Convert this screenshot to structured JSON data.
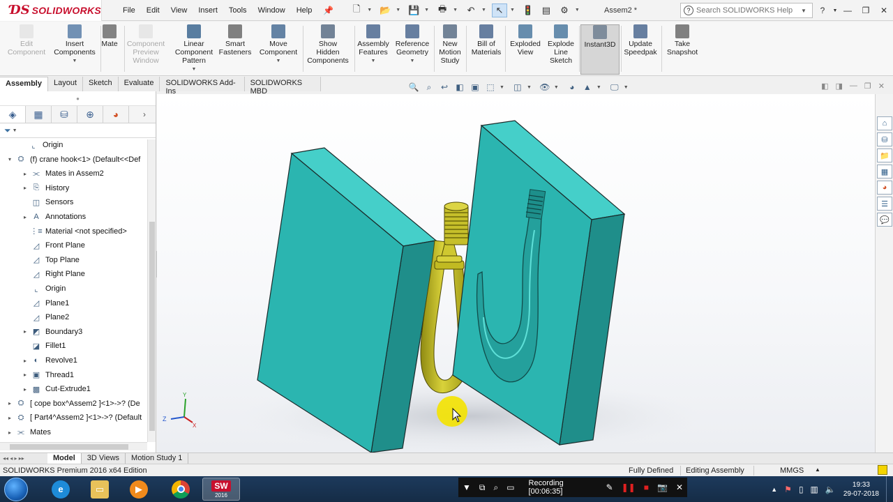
{
  "app": {
    "brand": "SOLIDWORKS",
    "doc_title": "Assem2 *",
    "search_placeholder": "Search SOLIDWORKS Help"
  },
  "menu": [
    "File",
    "Edit",
    "View",
    "Insert",
    "Tools",
    "Window",
    "Help"
  ],
  "commands": [
    {
      "id": "edit-component",
      "label": [
        "Edit",
        "Component"
      ],
      "disabled": true,
      "caret": false
    },
    {
      "id": "insert-components",
      "label": [
        "Insert",
        "Components"
      ],
      "disabled": false,
      "caret": true
    },
    {
      "id": "mate",
      "label": [
        "Mate"
      ],
      "disabled": false,
      "caret": false
    },
    {
      "id": "component-preview-window",
      "label": [
        "Component",
        "Preview",
        "Window"
      ],
      "disabled": true,
      "caret": false
    },
    {
      "id": "linear-component-pattern",
      "label": [
        "Linear",
        "Component",
        "Pattern"
      ],
      "disabled": false,
      "caret": true
    },
    {
      "id": "smart-fasteners",
      "label": [
        "Smart",
        "Fasteners"
      ],
      "disabled": false,
      "caret": false
    },
    {
      "id": "move-component",
      "label": [
        "Move",
        "Component"
      ],
      "disabled": false,
      "caret": true
    },
    {
      "id": "show-hidden-components",
      "label": [
        "Show",
        "Hidden",
        "Components"
      ],
      "disabled": false,
      "caret": false
    },
    {
      "id": "assembly-features",
      "label": [
        "Assembly",
        "Features"
      ],
      "disabled": false,
      "caret": true
    },
    {
      "id": "reference-geometry",
      "label": [
        "Reference",
        "Geometry"
      ],
      "disabled": false,
      "caret": true
    },
    {
      "id": "new-motion-study",
      "label": [
        "New",
        "Motion",
        "Study"
      ],
      "disabled": false,
      "caret": false
    },
    {
      "id": "bill-of-materials",
      "label": [
        "Bill of",
        "Materials"
      ],
      "disabled": false,
      "caret": false
    },
    {
      "id": "exploded-view",
      "label": [
        "Exploded",
        "View"
      ],
      "disabled": false,
      "caret": false
    },
    {
      "id": "explode-line-sketch",
      "label": [
        "Explode",
        "Line",
        "Sketch"
      ],
      "disabled": false,
      "caret": false
    },
    {
      "id": "instant3d",
      "label": [
        "Instant3D"
      ],
      "disabled": false,
      "caret": false,
      "active": true
    },
    {
      "id": "update-speedpak",
      "label": [
        "Update",
        "Speedpak"
      ],
      "disabled": false,
      "caret": false
    },
    {
      "id": "take-snapshot",
      "label": [
        "Take",
        "Snapshot"
      ],
      "disabled": false,
      "caret": false
    }
  ],
  "tabs": [
    "Assembly",
    "Layout",
    "Sketch",
    "Evaluate",
    "SOLIDWORKS Add-Ins",
    "SOLIDWORKS MBD"
  ],
  "active_tab": "Assembly",
  "tree": [
    {
      "label": "Origin",
      "depth": 1,
      "expander": "",
      "icon": "origin-icon"
    },
    {
      "label": "(f) crane hook<1> (Default<<Def",
      "depth": 0,
      "expander": "▾",
      "icon": "part-icon"
    },
    {
      "label": "Mates in Assem2",
      "depth": 2,
      "expander": "▸",
      "icon": "mates-icon"
    },
    {
      "label": "History",
      "depth": 2,
      "expander": "▸",
      "icon": "history-icon"
    },
    {
      "label": "Sensors",
      "depth": 2,
      "expander": "",
      "icon": "sensors-icon"
    },
    {
      "label": "Annotations",
      "depth": 2,
      "expander": "▸",
      "icon": "annotations-icon"
    },
    {
      "label": "Material <not specified>",
      "depth": 2,
      "expander": "",
      "icon": "material-icon"
    },
    {
      "label": "Front Plane",
      "depth": 2,
      "expander": "",
      "icon": "plane-icon"
    },
    {
      "label": "Top Plane",
      "depth": 2,
      "expander": "",
      "icon": "plane-icon"
    },
    {
      "label": "Right Plane",
      "depth": 2,
      "expander": "",
      "icon": "plane-icon"
    },
    {
      "label": "Origin",
      "depth": 2,
      "expander": "",
      "icon": "origin-icon"
    },
    {
      "label": "Plane1",
      "depth": 2,
      "expander": "",
      "icon": "plane-icon"
    },
    {
      "label": "Plane2",
      "depth": 2,
      "expander": "",
      "icon": "plane-icon"
    },
    {
      "label": "Boundary3",
      "depth": 2,
      "expander": "▸",
      "icon": "boundary-icon"
    },
    {
      "label": "Fillet1",
      "depth": 2,
      "expander": "",
      "icon": "fillet-icon"
    },
    {
      "label": "Revolve1",
      "depth": 2,
      "expander": "▸",
      "icon": "revolve-icon"
    },
    {
      "label": "Thread1",
      "depth": 2,
      "expander": "▸",
      "icon": "thread-icon"
    },
    {
      "label": "Cut-Extrude1",
      "depth": 2,
      "expander": "▸",
      "icon": "cut-extrude-icon"
    },
    {
      "label": "[ cope box^Assem2 ]<1>->? (De",
      "depth": 0,
      "expander": "▸",
      "icon": "part-icon"
    },
    {
      "label": "[ Part4^Assem2 ]<1>->? (Default",
      "depth": 0,
      "expander": "▸",
      "icon": "part-icon"
    },
    {
      "label": "Mates",
      "depth": 0,
      "expander": "▸",
      "icon": "mates-icon"
    }
  ],
  "bottom_tabs": [
    "Model",
    "3D Views",
    "Motion Study 1"
  ],
  "status": {
    "edition": "SOLIDWORKS Premium 2016 x64 Edition",
    "state": "Fully Defined",
    "mode": "Editing Assembly",
    "units": "MMGS"
  },
  "triad": {
    "y": "Y",
    "z": "Z",
    "x": "X"
  },
  "taskbar": {
    "recording": "Recording [00:06:35]",
    "time": "19:33",
    "date": "29-07-2018",
    "solidworks_badge": "SW",
    "solidworks_version": "2016"
  },
  "colors": {
    "mold": "#2bb5b0",
    "mold_side": "#1f8e8a",
    "mold_top": "#45cfc9",
    "hook": "#c9c225",
    "brand": "#c8102e",
    "taskbar": "#1d3a5c"
  }
}
